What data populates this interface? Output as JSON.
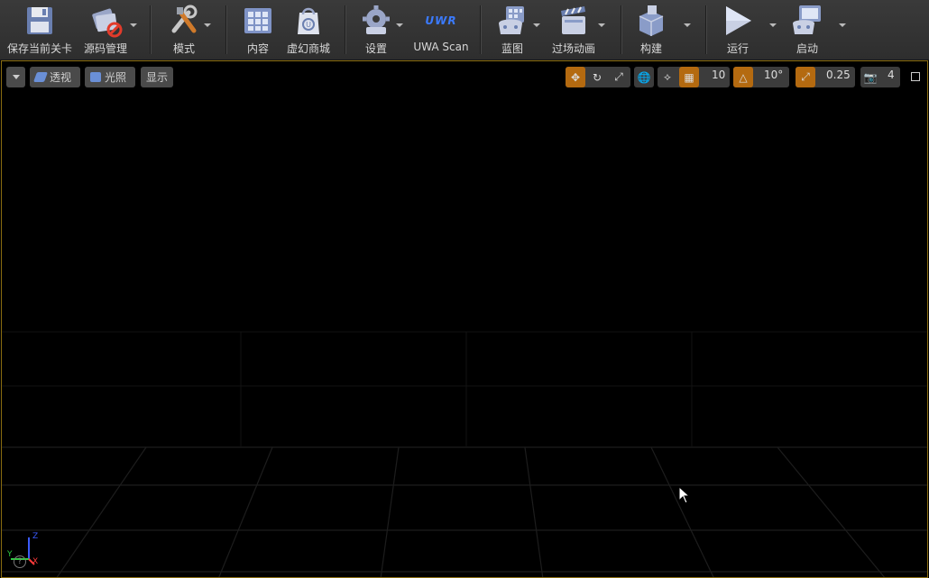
{
  "toolbar": {
    "buttons": [
      {
        "label": "保存当前关卡",
        "icon": "save-icon"
      },
      {
        "label": "源码管理",
        "icon": "source-control-icon"
      },
      {
        "label": "模式",
        "icon": "modes-icon"
      },
      {
        "label": "内容",
        "icon": "content-icon"
      },
      {
        "label": "虚幻商城",
        "icon": "marketplace-icon"
      },
      {
        "label": "设置",
        "icon": "settings-icon"
      },
      {
        "label": "UWA Scan",
        "icon": "uwa-icon",
        "icon_text": "UWR"
      },
      {
        "label": "蓝图",
        "icon": "blueprint-icon"
      },
      {
        "label": "过场动画",
        "icon": "cinematics-icon"
      },
      {
        "label": "构建",
        "icon": "build-icon"
      },
      {
        "label": "运行",
        "icon": "play-icon"
      },
      {
        "label": "启动",
        "icon": "launch-icon"
      }
    ]
  },
  "viewport": {
    "perspective_label": "透视",
    "lighting_label": "光照",
    "show_label": "显示",
    "grid_snap_value": "10",
    "rotation_snap_value": "10°",
    "scale_snap_value": "0.25",
    "camera_speed_value": "4",
    "axis_labels": {
      "x": "X",
      "y": "Y",
      "z": "Z"
    },
    "help_glyph": "?"
  },
  "colors": {
    "toolbar_bg": "#333333",
    "viewport_border": "#8a6d10",
    "active_orange": "#b46a10",
    "uwa_blue": "#3b7bff"
  }
}
